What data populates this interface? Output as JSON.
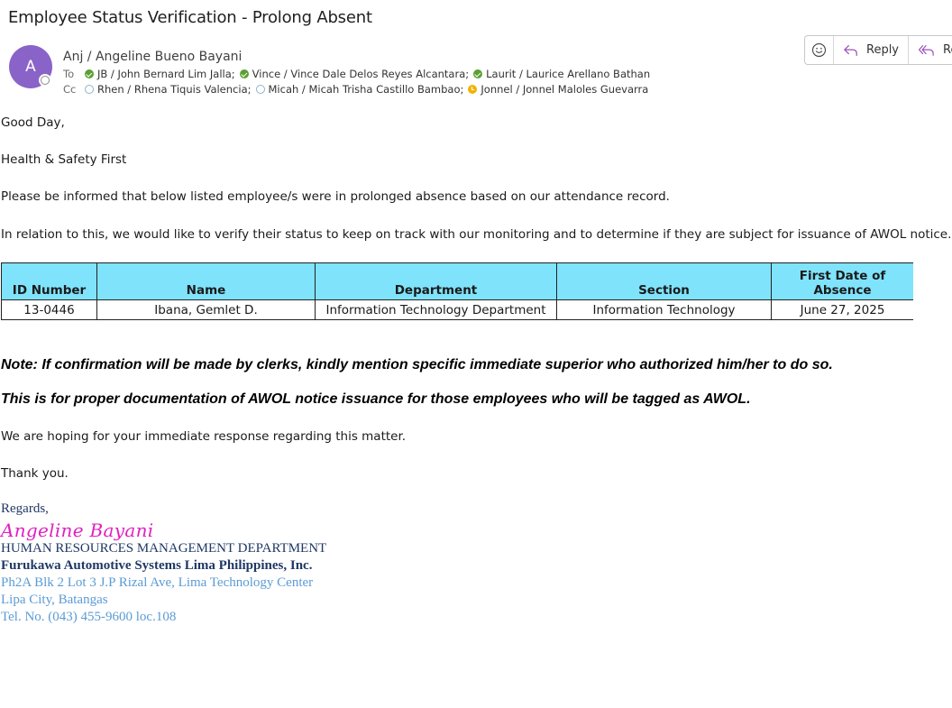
{
  "email": {
    "subject": "Employee Status Verification - Prolong Absent",
    "sender": {
      "initial": "A",
      "name": "Anj / Angeline Bueno Bayani",
      "avatar_color": "#8a63c9"
    },
    "to_label": "To",
    "cc_label": "Cc",
    "to": [
      {
        "name": "JB / John Bernard Lim Jalla;",
        "status": "available"
      },
      {
        "name": "Vince / Vince Dale Delos Reyes Alcantara;",
        "status": "available"
      },
      {
        "name": "Laurit / Laurice Arellano Bathan",
        "status": "available"
      }
    ],
    "cc": [
      {
        "name": "Rhen / Rhena Tiquis Valencia;",
        "status": "offline"
      },
      {
        "name": "Micah / Micah Trisha Castillo Bambao;",
        "status": "offline"
      },
      {
        "name": "Jonnel / Jonnel Maloles Guevarra",
        "status": "away"
      }
    ],
    "actions": {
      "emoji_icon": "smiley-icon",
      "reply_label": "Reply",
      "reply_all_label": "Rep"
    }
  },
  "body": {
    "greeting": "Good Day,",
    "line1": "Health & Safety First",
    "line2": "Please be informed that below listed employee/s were in prolonged absence based on our attendance record.",
    "line3": "In relation to this, we would like to verify their status to keep on track with our monitoring and to determine if they are subject for issuance of AWOL notice.",
    "table": {
      "headers": [
        "ID Number",
        "Name",
        "Department",
        "Section",
        "First Date of Absence"
      ],
      "rows": [
        [
          "13-0446",
          "Ibana, Gemlet D.",
          "Information Technology Department",
          "Information Technology",
          "June 27, 2025"
        ]
      ],
      "header_color": "#7fe3fb"
    },
    "note1": "Note: If confirmation will be made by clerks, kindly mention specific immediate superior who authorized him/her to do so.",
    "note2": "This is for proper documentation of AWOL notice issuance for those employees who will be tagged as AWOL.",
    "line4": "We are hoping for your immediate response regarding this matter.",
    "thanks": "Thank you."
  },
  "signature": {
    "regards": "Regards,",
    "name": "Angeline Bayani",
    "department": "HUMAN RESOURCES MANAGEMENT DEPARTMENT",
    "company": "Furukawa Automotive Systems Lima Philippines, Inc.",
    "address1": "Ph2A Blk 2 Lot 3 J.P Rizal Ave, Lima Technology Center",
    "address2": "Lipa City, Batangas",
    "phone": "Tel. No. (043) 455-9600 loc.108",
    "name_color": "#e21fbf",
    "text_color": "#1f3864",
    "address_color": "#5b9bd5"
  }
}
